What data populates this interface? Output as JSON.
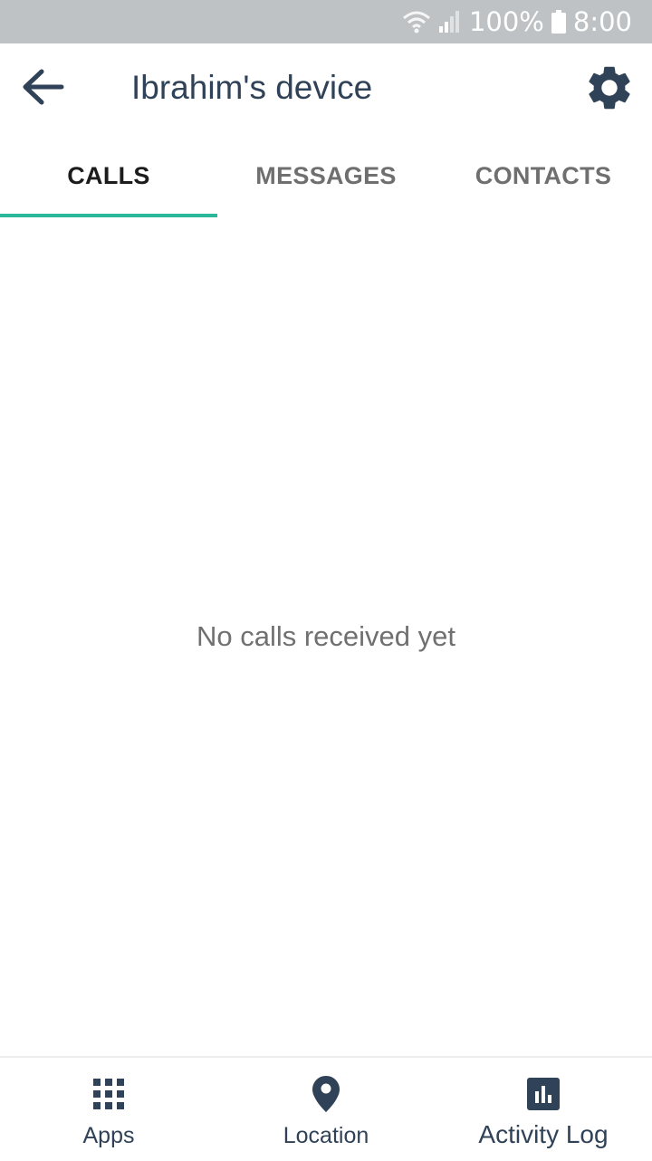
{
  "status_bar": {
    "battery": "100%",
    "time": "8:00",
    "icons": [
      "wifi-icon",
      "signal-icon",
      "battery-icon"
    ]
  },
  "app_bar": {
    "title": "Ibrahim's device",
    "back_icon": "arrow-left-icon",
    "settings_icon": "gear-icon"
  },
  "tabs": [
    {
      "label": "CALLS",
      "active": true
    },
    {
      "label": "MESSAGES",
      "active": false
    },
    {
      "label": "CONTACTS",
      "active": false
    }
  ],
  "main": {
    "empty_message": "No calls received yet"
  },
  "bottom_nav": [
    {
      "label": "Apps",
      "icon": "apps-grid-icon"
    },
    {
      "label": "Location",
      "icon": "location-pin-icon"
    },
    {
      "label": "Activity Log",
      "icon": "bar-chart-icon"
    }
  ],
  "colors": {
    "status_bar": "#bfc2c5",
    "primary_text": "#2f4257",
    "tab_indicator": "#2ab79a",
    "inactive_tab": "#6f6f6f",
    "active_tab": "#1c1c1c",
    "empty_text": "#707070"
  }
}
